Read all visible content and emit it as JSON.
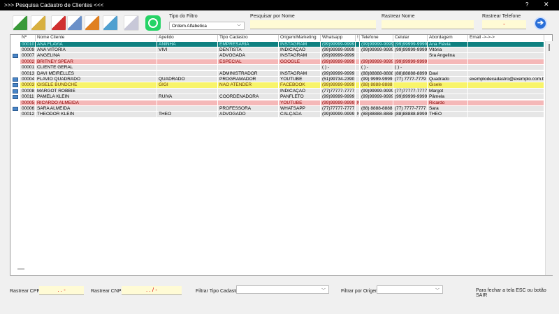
{
  "window": {
    "title": ">>> Pesquisa Cadastro de Clientes <<<",
    "help": "?",
    "close": "✕"
  },
  "toolbar": {
    "buttons": [
      {
        "name": "add-icon",
        "color": "#3a9a3a"
      },
      {
        "name": "edit-icon",
        "color": "#d8b040"
      },
      {
        "name": "delete-icon",
        "color": "#d03030"
      },
      {
        "name": "print-icon",
        "color": "#6a90c8"
      },
      {
        "name": "export-icon",
        "color": "#e08020"
      },
      {
        "name": "image-icon",
        "color": "#50a0d0"
      },
      {
        "name": "email-icon",
        "color": "#c8c8d8"
      },
      {
        "name": "whatsapp-icon",
        "color": "#25d366"
      }
    ]
  },
  "filters": {
    "tipo_filtro_label": "Tipo do Filtro",
    "tipo_filtro_value": "Ordem Alfabetica",
    "pesquisar_nome_label": "Pesquisar por Nome",
    "pesquisar_nome_value": "",
    "rastrear_nome_label": "Rastrear Nome",
    "rastrear_nome_value": "",
    "rastrear_telefone_label": "Rastrear Telefone",
    "rastrear_telefone_value": "-"
  },
  "grid": {
    "columns": [
      "Nº",
      "Nome Cliente",
      "Apelido",
      "Tipo Cadastro",
      "Origem/Marketing",
      "Whatsapp",
      "!",
      "Telefone",
      "Celular",
      "Abordagem",
      "Email ->->->"
    ],
    "rows": [
      {
        "style": "sel",
        "icon": false,
        "cells": [
          "00010",
          "ANA FLAVIA",
          "ANINHA",
          "EMPRESARIA",
          "INSTAGRAM",
          "(99)99999-9999",
          "",
          "(99)99999-9999",
          "(99)99999-9999",
          "Ana Flávia",
          ""
        ]
      },
      {
        "style": "normal",
        "icon": false,
        "cells": [
          "00009",
          "ANA VITÓRIA",
          "VIVI",
          "DENTISTA",
          "INDICAÇÃO",
          "(99)99999-9999",
          "",
          "(99)99999-9999",
          "(99)99999-9999",
          "Vitória",
          ""
        ]
      },
      {
        "style": "normal",
        "icon": true,
        "cells": [
          "00007",
          "ANGELINA",
          "",
          "ADVOGADA",
          "INSTAGRAM",
          "(99)99999-9999",
          "",
          "",
          "",
          "Sra Angelina",
          ""
        ]
      },
      {
        "style": "pink",
        "icon": false,
        "cells": [
          "00002",
          "BRITNEY SPEAR",
          "",
          "ESPECIAL",
          "GOOGLE",
          "(99)99999-9999",
          "",
          "(99)99999-9999",
          "(99)99999-9999",
          "",
          ""
        ]
      },
      {
        "style": "normal",
        "icon": false,
        "cells": [
          "00001",
          "CLIENTE GERAL",
          "",
          "",
          "",
          "(  )     -",
          "",
          "(  )     -",
          "(  )     -",
          "",
          ""
        ]
      },
      {
        "style": "normal",
        "icon": false,
        "cells": [
          "00013",
          "DAVI MEIRELLES",
          "",
          "ADMINISTRADOR",
          "INSTAGRAM",
          "(99)99999-9999",
          "",
          "(88)88888-8888",
          "(88)88888-8899",
          "Davi",
          ""
        ]
      },
      {
        "style": "normal",
        "icon": true,
        "cells": [
          "00004",
          "FLAVIO QUADRADO",
          "QUADRADO",
          "PROGRAMADOR",
          "YOUTUBE",
          "(51)99734-2390",
          "",
          "(99) 9999-9999",
          "(77) 7777-7779",
          "Quadrado",
          "exemplodecadastro@exemplo.com.br"
        ]
      },
      {
        "style": "yellow",
        "icon": true,
        "cells": [
          "00003",
          "GISELE BUNDCHE",
          "GIGI",
          "NAO ATENDER",
          "FACEBOOK",
          "(99)99999-9999",
          "",
          "(88) 8888-8888",
          "",
          "Gisele",
          ""
        ]
      },
      {
        "style": "normal",
        "icon": true,
        "cells": [
          "00008",
          "MARGOT ROBBIE",
          "",
          "",
          "INDICAÇÃO",
          "(77)77777-7777",
          "",
          "(99)99999-9999",
          "(77)77777-7777",
          "Margot",
          ""
        ]
      },
      {
        "style": "normal",
        "icon": true,
        "cells": [
          "00011",
          "PAMELA KLEIN",
          "RUIVA",
          "COORDENADORA",
          "PANFLETO",
          "(99)99999-9999",
          "",
          "(99)99999-9999",
          "(99)99999-9999",
          "Pâmela",
          ""
        ]
      },
      {
        "style": "pink",
        "icon": false,
        "cells": [
          "00005",
          "RICARDO ALMEIDA",
          "",
          "",
          "YOUTUBE",
          "(99)99999-9999",
          "N",
          "",
          "",
          "Ricardo",
          ""
        ]
      },
      {
        "style": "normal",
        "icon": true,
        "cells": [
          "00006",
          "SARA ALMEIDA",
          "",
          "PROFESSORA",
          "WHATSAPP",
          "(77)77777-7777",
          "",
          "(88) 8888-8888",
          "(77) 7777-7777",
          "Sara",
          ""
        ]
      },
      {
        "style": "normal",
        "icon": false,
        "cells": [
          "00012",
          "THEODOR KLEIN",
          "THEO",
          "ADVOGADO",
          "CALÇADA",
          "(99)99999-9999",
          "N",
          "(88)88888-8888",
          "(88)88888-8999",
          "THEO",
          ""
        ]
      }
    ]
  },
  "bottom": {
    "cpf_label": "Rastrear CPF",
    "cpf_value": ".   .   -",
    "cnpj_label": "Rastrear CNPJ",
    "cnpj_value": ".   .   /   -",
    "tipo_label": "Filtrar Tipo Cadastro",
    "tipo_value": "",
    "origem_label": "Filtrar por Origem",
    "origem_value": "",
    "hint": "Para fechar a tela ESC ou botão SAIR"
  },
  "colors": {
    "selected": "#0e8080",
    "pink": "#f5b8b8",
    "yellow": "#f8f46a",
    "input": "#fffbd5"
  }
}
